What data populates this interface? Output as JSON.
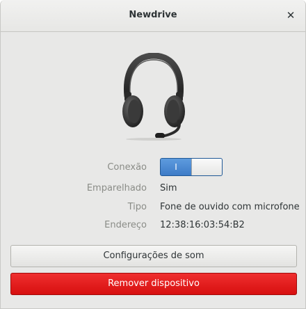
{
  "window": {
    "title": "Newdrive",
    "close_glyph": "✕"
  },
  "device": {
    "icon": "headset-icon",
    "rows": {
      "connection": {
        "label": "Conexão",
        "switch_on_glyph": "I",
        "state": "on"
      },
      "paired": {
        "label": "Emparelhado",
        "value": "Sim"
      },
      "type": {
        "label": "Tipo",
        "value": "Fone de ouvido com microfone"
      },
      "address": {
        "label": "Endereço",
        "value": "12:38:16:03:54:B2"
      }
    }
  },
  "buttons": {
    "sound_settings": "Configurações de som",
    "remove_device": "Remover dispositivo"
  },
  "colors": {
    "switch_accent": "#4a86cf",
    "destructive": "#e21b1b"
  }
}
